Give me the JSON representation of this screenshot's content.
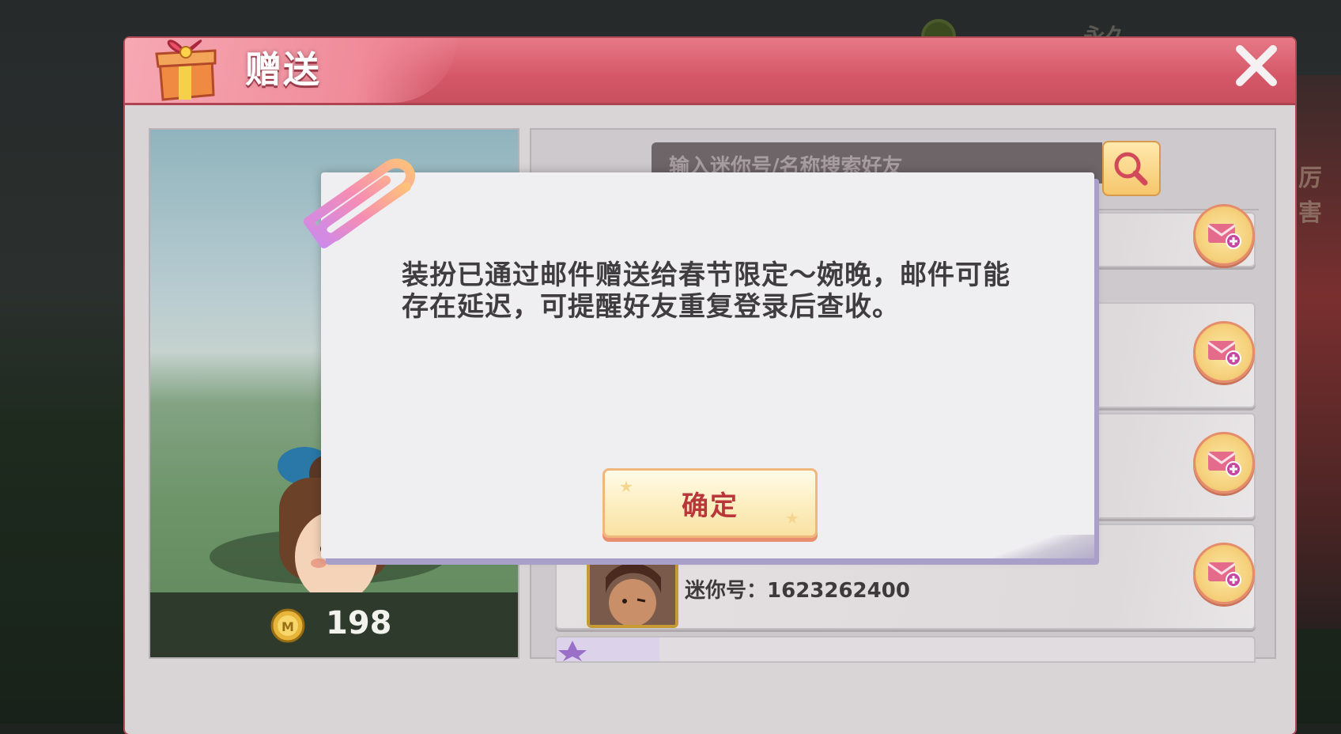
{
  "background": {
    "top_text": "永久",
    "right_text": "厉害"
  },
  "panel": {
    "title": "赠送",
    "icons": {
      "header": "gift-box-icon",
      "close": "close-icon"
    }
  },
  "preview": {
    "coin_icon": "mini-coin-icon",
    "coin_value": "198"
  },
  "friends": {
    "search_placeholder": "输入迷你号/名称搜索好友",
    "search_icon": "magnifier-icon",
    "visible_row": {
      "label": "迷你号：",
      "id": "1623262400"
    },
    "row_action_icon": "send-mail-icon"
  },
  "dialog": {
    "message": "装扮已通过邮件赠送给春节限定～婉晚，邮件可能存在延迟，可提醒好友重复登录后查收。",
    "confirm_label": "确定",
    "decoration_icon": "paperclip-icon"
  },
  "colors": {
    "header": "#d45767",
    "panel": "#d9d5d7",
    "dialog": "#efeef1",
    "confirm_text": "#b9373a",
    "button_border": "#f0b77a"
  }
}
